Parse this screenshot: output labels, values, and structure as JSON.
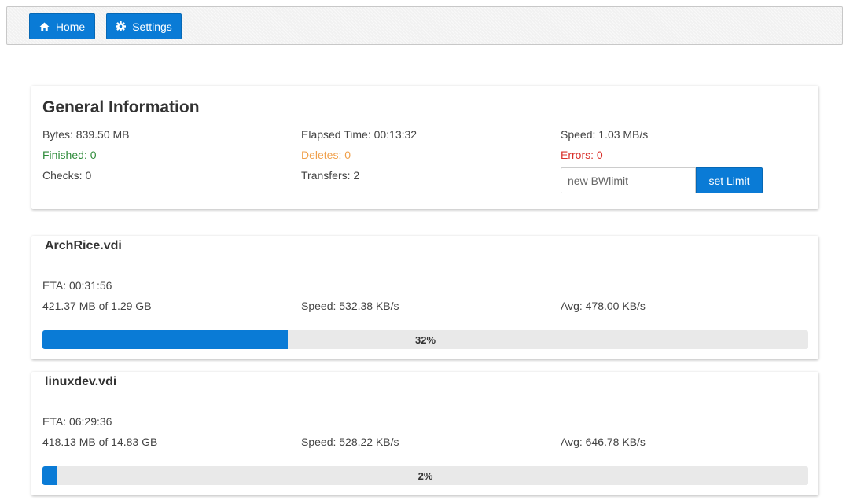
{
  "nav": {
    "home_label": "Home",
    "home_icon": "home-icon",
    "settings_label": "Settings",
    "settings_icon": "gear-icon",
    "accent": "#0a7bd6"
  },
  "general": {
    "title": "General Information",
    "bytes": "Bytes: 839.50 MB",
    "elapsed": "Elapsed Time: 00:13:32",
    "speed": "Speed: 1.03 MB/s",
    "finished": "Finished: 0",
    "deletes": "Deletes: 0",
    "errors": "Errors: 0",
    "checks": "Checks: 0",
    "transfers": "Transfers: 2",
    "bw_placeholder": "new BWlimit",
    "bw_button": "set Limit",
    "colors": {
      "finished": "#2e8b3a",
      "deletes": "#f0a04b",
      "errors": "#d9302a"
    }
  },
  "transfers": [
    {
      "name": "ArchRice.vdi",
      "eta": "ETA: 00:31:56",
      "size": "421.37 MB of 1.29 GB",
      "speed": "Speed: 532.38 KB/s",
      "avg": "Avg: 478.00 KB/s",
      "percent": 32,
      "percent_label": "32%"
    },
    {
      "name": "linuxdev.vdi",
      "eta": "ETA: 06:29:36",
      "size": "418.13 MB of 14.83 GB",
      "speed": "Speed: 528.22 KB/s",
      "avg": "Avg: 646.78 KB/s",
      "percent": 2,
      "percent_label": "2%"
    }
  ]
}
